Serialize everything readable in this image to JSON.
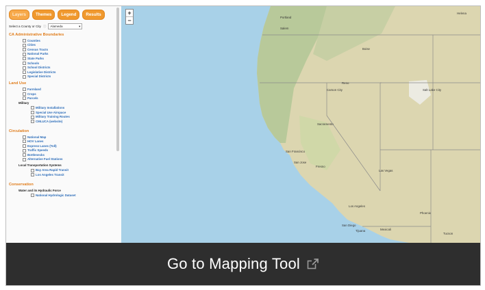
{
  "tabs": [
    "Layers",
    "Themes",
    "Legend",
    "Results"
  ],
  "county": {
    "label": "Select a County or City",
    "value": "Alameda"
  },
  "sections": [
    {
      "title": "CA Administrative Boundaries",
      "items": [
        "Counties",
        "Cities",
        "Census Tracts",
        "National Parks",
        "State Parks",
        "Schools",
        "School Districts",
        "Legislative Districts",
        "Special Districts"
      ]
    },
    {
      "title": "Land Use"
    }
  ],
  "landuse": [
    "Farmland",
    "Crops",
    "Parcels"
  ],
  "military": {
    "label": "Military",
    "items": [
      "Military Installations",
      "Special Use Airspace",
      "Military Training Routes",
      "CMLUCA (website)"
    ]
  },
  "circulation": {
    "title": "Circulation",
    "items": [
      "National Map",
      "HOV Lanes",
      "Express Lanes (Toll)",
      "Traffic Speeds",
      "Bottlenecks",
      "Alternative Fuel Stations"
    ]
  },
  "local_transport": {
    "label": "Local Transportation Systems",
    "items": [
      "Bay Area Rapid Transit",
      "Los Angeles Transit"
    ]
  },
  "conservation": {
    "title": "Conservation",
    "group": "Water and its Hydraulic Force",
    "item": "National Hydrologic Dataset"
  },
  "map_labels": [
    "Portland",
    "Salem",
    "Boise",
    "Salt Lake City",
    "Reno",
    "Carson City",
    "Sacramento",
    "San Francisco",
    "San Jose",
    "Fresno",
    "Las Vegas",
    "Los Angeles",
    "San Diego",
    "Tijuana",
    "Mexicali",
    "Phoenix",
    "Tucson",
    "Helena"
  ],
  "zoom": {
    "in": "+",
    "out": "−"
  },
  "footer": {
    "text": "Go to Mapping Tool",
    "icon": "external-link-icon"
  },
  "colors": {
    "accent": "#f0992e",
    "section": "#e07c1a",
    "link": "#2a6bb8",
    "footer_bg": "#2e2e2e",
    "water": "#a8d1e8"
  }
}
